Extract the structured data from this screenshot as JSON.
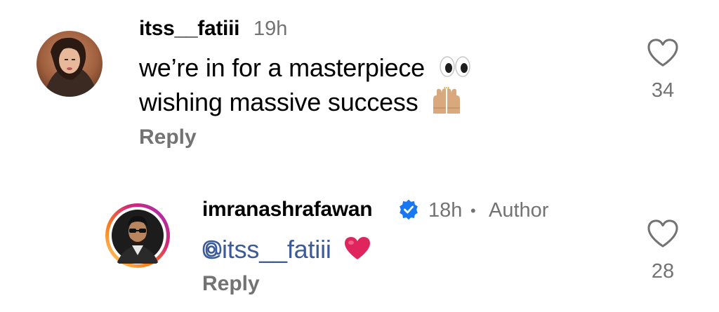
{
  "comments": [
    {
      "username": "itss__fatiii",
      "time": "19h",
      "lines": [
        "we’re in for a masterpiece",
        "wishing massive success"
      ],
      "emojis": [
        "eyes",
        "raising-hands"
      ],
      "reply_label": "Reply",
      "likes": "34"
    },
    {
      "username": "imranashrafawan",
      "time": "18h",
      "separator": "•",
      "badge": "Author",
      "mention": "itss__fatiii",
      "reply_label": "Reply",
      "likes": "28"
    }
  ],
  "colors": {
    "meta_gray": "#737373",
    "mention_blue": "#3a5a9a",
    "verified_blue": "#1877f2",
    "heart_red": "#e0245e"
  },
  "icons": [
    "heart-outline-icon",
    "verified-icon",
    "mention-at-icon",
    "eyes-emoji",
    "raising-hands-emoji",
    "red-heart-emoji"
  ]
}
